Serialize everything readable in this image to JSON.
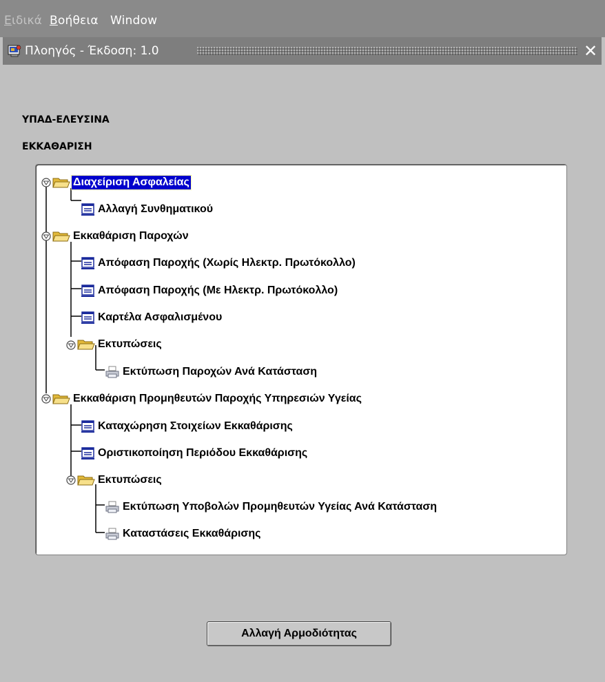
{
  "menubar": {
    "items": [
      {
        "label": "Ειδικά",
        "mnemonic": "Ε",
        "rest": "ιδικά",
        "enabled": false
      },
      {
        "label": "Βοήθεια",
        "mnemonic": "Β",
        "rest": "οήθεια",
        "enabled": true
      },
      {
        "label": "Window",
        "mnemonic": "",
        "rest": "Window",
        "enabled": true
      }
    ]
  },
  "window": {
    "title": "Πλοηγός - Έκδοση: 1.0",
    "icon": "oracle-forms-app-icon",
    "close_glyph": "✕"
  },
  "header": {
    "organization": "ΥΠΑΔ-ΕΛΕΥΣΙΝΑ",
    "role": "ΕΚΚΑΘΑΡΙΣΗ"
  },
  "tree": {
    "nodes": [
      {
        "label": "Διαχείριση Ασφαλείας",
        "type": "folder",
        "level": 0,
        "expanded": true,
        "selected": true
      },
      {
        "label": "Αλλαγή Συνθηματικού",
        "type": "form",
        "level": 1
      },
      {
        "label": "Εκκαθάριση Παροχών",
        "type": "folder",
        "level": 0,
        "expanded": true
      },
      {
        "label": "Απόφαση Παροχής (Χωρίς Ηλεκτρ. Πρωτόκολλο)",
        "type": "form",
        "level": 1
      },
      {
        "label": "Απόφαση Παροχής (Με Ηλεκτρ. Πρωτόκολλο)",
        "type": "form",
        "level": 1
      },
      {
        "label": "Καρτέλα Ασφαλισμένου",
        "type": "form",
        "level": 1
      },
      {
        "label": "Εκτυπώσεις",
        "type": "folder",
        "level": 1,
        "expanded": true
      },
      {
        "label": "Εκτύπωση Παροχών Ανά Κατάσταση",
        "type": "report",
        "level": 2
      },
      {
        "label": "Εκκαθάριση Προμηθευτών Παροχής Υπηρεσιών Υγείας",
        "type": "folder",
        "level": 0,
        "expanded": true
      },
      {
        "label": "Καταχώρηση Στοιχείων Εκκαθάρισης",
        "type": "form",
        "level": 1
      },
      {
        "label": "Οριστικοποίηση Περιόδου Εκκαθάρισης",
        "type": "form",
        "level": 1
      },
      {
        "label": "Εκτυπώσεις",
        "type": "folder",
        "level": 1,
        "expanded": true
      },
      {
        "label": "Εκτύπωση Υποβολών Προμηθευτών Υγείας Ανά Κατάσταση",
        "type": "report",
        "level": 2
      },
      {
        "label": "Καταστάσεις Εκκαθάρισης",
        "type": "report",
        "level": 2
      }
    ]
  },
  "actions": {
    "change_role": "Αλλαγή Αρμοδιότητας"
  },
  "colors": {
    "selection": "#0000cc",
    "folder": "#f2d46b",
    "form_icon": "#1a2a9c",
    "title_bar": "#7e7e7e"
  }
}
